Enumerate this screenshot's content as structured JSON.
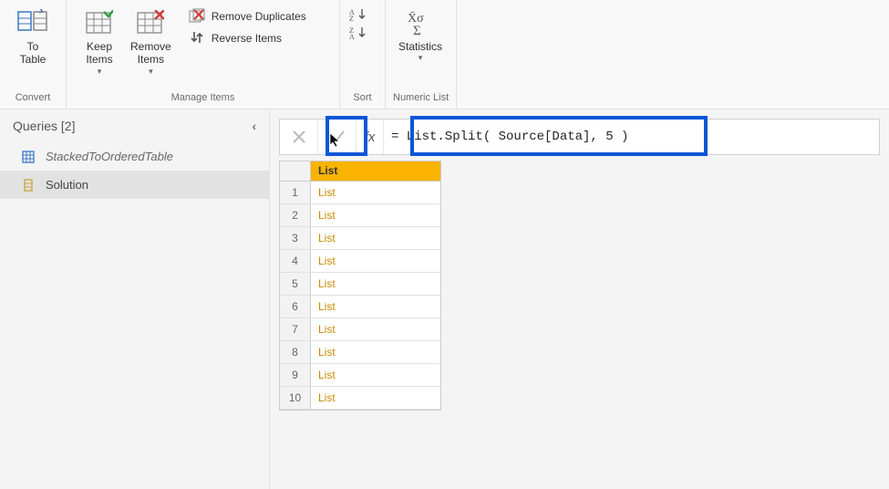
{
  "ribbon": {
    "convert": {
      "group_label": "Convert",
      "to_table": "To\nTable"
    },
    "manage_items": {
      "group_label": "Manage Items",
      "keep_items": "Keep\nItems",
      "remove_items": "Remove\nItems",
      "remove_duplicates": "Remove Duplicates",
      "reverse_items": "Reverse Items"
    },
    "sort": {
      "group_label": "Sort"
    },
    "numeric_list": {
      "group_label": "Numeric List",
      "statistics": "Statistics"
    }
  },
  "queries_panel": {
    "title": "Queries [2]",
    "items": [
      {
        "label": "StackedToOrderedTable",
        "italic": true,
        "selected": false,
        "type": "table"
      },
      {
        "label": "Solution",
        "italic": false,
        "selected": true,
        "type": "list"
      }
    ]
  },
  "formula": {
    "fx": "fx",
    "value": "= List.Split( Source[Data], 5 )"
  },
  "grid": {
    "header": "List",
    "rows": [
      {
        "n": "1",
        "v": "List"
      },
      {
        "n": "2",
        "v": "List"
      },
      {
        "n": "3",
        "v": "List"
      },
      {
        "n": "4",
        "v": "List"
      },
      {
        "n": "5",
        "v": "List"
      },
      {
        "n": "6",
        "v": "List"
      },
      {
        "n": "7",
        "v": "List"
      },
      {
        "n": "8",
        "v": "List"
      },
      {
        "n": "9",
        "v": "List"
      },
      {
        "n": "10",
        "v": "List"
      }
    ]
  }
}
